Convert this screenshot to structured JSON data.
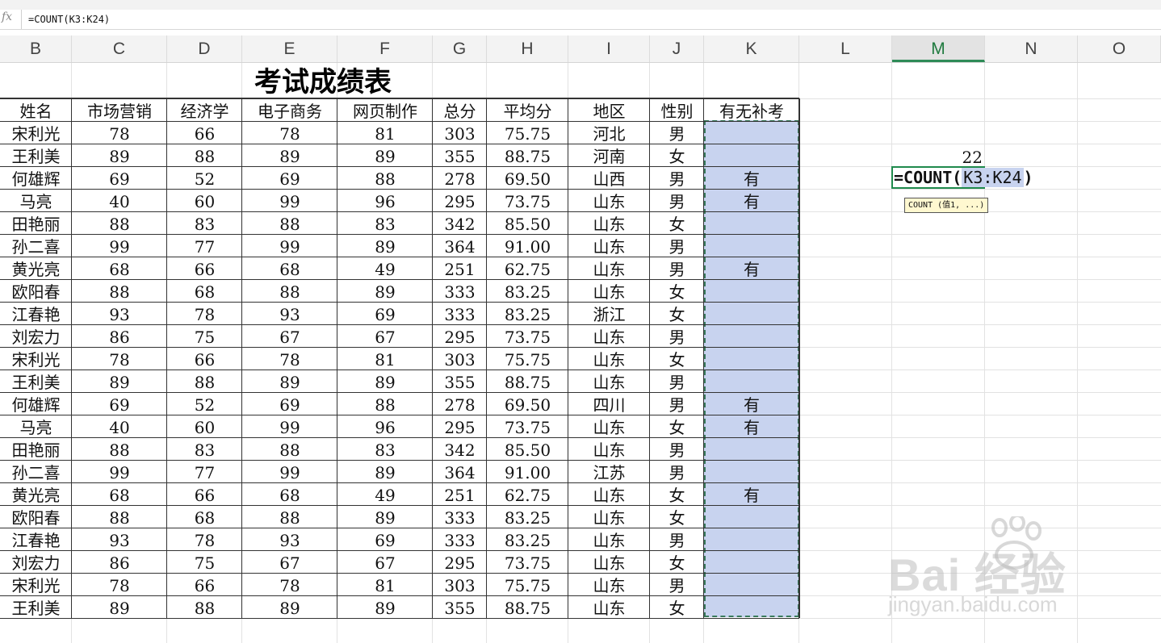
{
  "formula_bar": {
    "fx_label": "fx",
    "formula": "=COUNT(K3:K24)"
  },
  "columns": [
    "B",
    "C",
    "D",
    "E",
    "F",
    "G",
    "H",
    "I",
    "J",
    "K",
    "L",
    "M",
    "N",
    "O"
  ],
  "active_column": "M",
  "sheet": {
    "title": "考试成绩表",
    "headers": [
      "姓名",
      "市场营销",
      "经济学",
      "电子商务",
      "网页制作",
      "总分",
      "平均分",
      "地区",
      "性别",
      "有无补考"
    ],
    "rows": [
      [
        "宋利光",
        "78",
        "66",
        "78",
        "81",
        "303",
        "75.75",
        "河北",
        "男",
        ""
      ],
      [
        "王利美",
        "89",
        "88",
        "89",
        "89",
        "355",
        "88.75",
        "河南",
        "女",
        ""
      ],
      [
        "何雄辉",
        "69",
        "52",
        "69",
        "88",
        "278",
        "69.50",
        "山西",
        "男",
        "有"
      ],
      [
        "马亮",
        "40",
        "60",
        "99",
        "96",
        "295",
        "73.75",
        "山东",
        "男",
        "有"
      ],
      [
        "田艳丽",
        "88",
        "83",
        "88",
        "83",
        "342",
        "85.50",
        "山东",
        "女",
        ""
      ],
      [
        "孙二喜",
        "99",
        "77",
        "99",
        "89",
        "364",
        "91.00",
        "山东",
        "男",
        ""
      ],
      [
        "黄光亮",
        "68",
        "66",
        "68",
        "49",
        "251",
        "62.75",
        "山东",
        "男",
        "有"
      ],
      [
        "欧阳春",
        "88",
        "68",
        "88",
        "89",
        "333",
        "83.25",
        "山东",
        "女",
        ""
      ],
      [
        "江春艳",
        "93",
        "78",
        "93",
        "69",
        "333",
        "83.25",
        "浙江",
        "女",
        ""
      ],
      [
        "刘宏力",
        "86",
        "75",
        "67",
        "67",
        "295",
        "73.75",
        "山东",
        "男",
        ""
      ],
      [
        "宋利光",
        "78",
        "66",
        "78",
        "81",
        "303",
        "75.75",
        "山东",
        "女",
        ""
      ],
      [
        "王利美",
        "89",
        "88",
        "89",
        "89",
        "355",
        "88.75",
        "山东",
        "男",
        ""
      ],
      [
        "何雄辉",
        "69",
        "52",
        "69",
        "88",
        "278",
        "69.50",
        "四川",
        "男",
        "有"
      ],
      [
        "马亮",
        "40",
        "60",
        "99",
        "96",
        "295",
        "73.75",
        "山东",
        "女",
        "有"
      ],
      [
        "田艳丽",
        "88",
        "83",
        "88",
        "83",
        "342",
        "85.50",
        "山东",
        "男",
        ""
      ],
      [
        "孙二喜",
        "99",
        "77",
        "99",
        "89",
        "364",
        "91.00",
        "江苏",
        "男",
        ""
      ],
      [
        "黄光亮",
        "68",
        "66",
        "68",
        "49",
        "251",
        "62.75",
        "山东",
        "女",
        "有"
      ],
      [
        "欧阳春",
        "88",
        "68",
        "88",
        "89",
        "333",
        "83.25",
        "山东",
        "女",
        ""
      ],
      [
        "江春艳",
        "93",
        "78",
        "93",
        "69",
        "333",
        "83.25",
        "山东",
        "男",
        ""
      ],
      [
        "刘宏力",
        "86",
        "75",
        "67",
        "67",
        "295",
        "73.75",
        "山东",
        "女",
        ""
      ],
      [
        "宋利光",
        "78",
        "66",
        "78",
        "81",
        "303",
        "75.75",
        "山东",
        "男",
        ""
      ],
      [
        "王利美",
        "89",
        "88",
        "89",
        "89",
        "355",
        "88.75",
        "山东",
        "女",
        ""
      ]
    ]
  },
  "side": {
    "result_value": "22",
    "edit_prefix": "=COUNT(",
    "edit_ref": "K3:K24",
    "edit_suffix": ")",
    "tooltip": "COUNT (值1, ...)"
  },
  "watermark": {
    "brand": "Bai  经验",
    "url": "jingyan.baidu.com"
  },
  "colors": {
    "selection": "#c8d3ef",
    "active_header": "#2e8b57"
  }
}
